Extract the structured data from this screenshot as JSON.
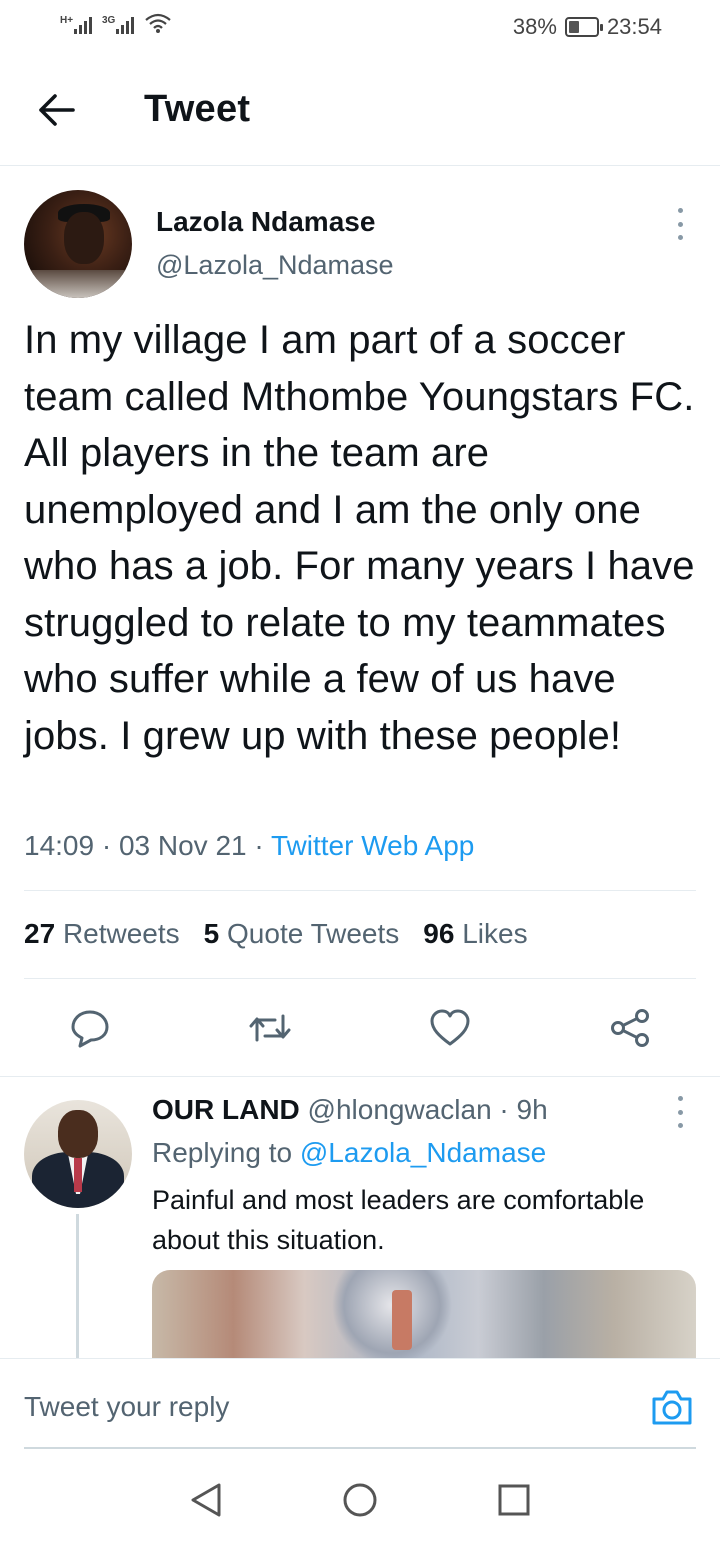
{
  "status_bar": {
    "signal1_label": "H+",
    "signal2_label": "3G",
    "battery_text": "38%",
    "battery_level": 0.38,
    "time": "23:54"
  },
  "header": {
    "title": "Tweet",
    "back_icon": "arrow-left-icon"
  },
  "tweet": {
    "author_name": "Lazola Ndamase",
    "author_handle": "@Lazola_Ndamase",
    "text": "In my village I am part of a soccer team called Mthombe Youngstars FC. All players in the team are unemployed and I am the only one who has a job. For many years I have struggled to relate to my teammates who suffer while a few of us have jobs. I grew up with these people!",
    "time": "14:09",
    "date": "03 Nov 21",
    "separator": "·",
    "source": "Twitter Web App",
    "stats": {
      "retweets_count": "27",
      "retweets_label": "Retweets",
      "quotes_count": "5",
      "quotes_label": "Quote Tweets",
      "likes_count": "96",
      "likes_label": "Likes"
    },
    "actions": [
      "reply-icon",
      "retweet-icon",
      "like-icon",
      "share-icon"
    ]
  },
  "reply": {
    "author_name": "OUR LAND",
    "author_handle": "@hlongwaclan",
    "age": "9h",
    "separator": "·",
    "replying_label": "Replying to",
    "replying_mention": "@Lazola_Ndamase",
    "text": "Painful and most leaders are comfortable about this situation."
  },
  "composer": {
    "placeholder": "Tweet your reply",
    "camera_icon": "camera-icon"
  },
  "nav": [
    "back-triangle-icon",
    "home-circle-icon",
    "recents-square-icon"
  ],
  "colors": {
    "accent": "#1d9bf0",
    "secondary_text": "#536471",
    "primary_text": "#0f1419",
    "divider": "#e6ecf0"
  }
}
